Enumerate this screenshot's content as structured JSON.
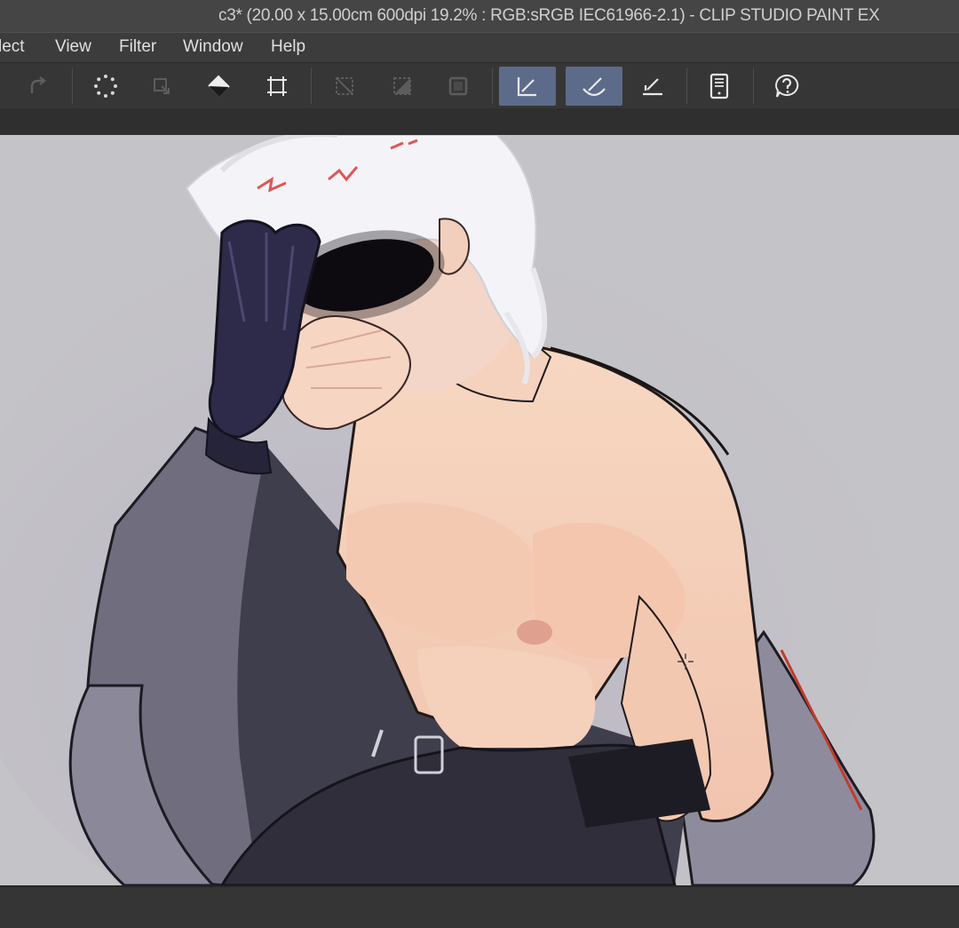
{
  "window": {
    "title": "c3* (20.00 x 15.00cm 600dpi 19.2% : RGB:sRGB IEC61966-2.1)  - CLIP STUDIO PAINT EX"
  },
  "menu": {
    "items": [
      {
        "label": "lect"
      },
      {
        "label": "View"
      },
      {
        "label": "Filter"
      },
      {
        "label": "Window"
      },
      {
        "label": "Help"
      }
    ]
  },
  "toolbar": {
    "buttons": [
      {
        "icon": "redo-icon",
        "state": "disabled"
      },
      {
        "icon": "loading-spinner-icon",
        "state": "normal"
      },
      {
        "icon": "transform-layer-icon",
        "state": "disabled"
      },
      {
        "icon": "fill-bucket-icon",
        "state": "normal"
      },
      {
        "icon": "crop-transform-icon",
        "state": "normal"
      },
      {
        "icon": "deselect-icon",
        "state": "disabled"
      },
      {
        "icon": "invert-selection-icon",
        "state": "disabled"
      },
      {
        "icon": "selection-border-icon",
        "state": "disabled"
      },
      {
        "icon": "snap-to-ruler-icon",
        "state": "active"
      },
      {
        "icon": "snap-to-special-ruler-icon",
        "state": "active"
      },
      {
        "icon": "snap-to-grid-icon",
        "state": "normal"
      },
      {
        "icon": "device-view-icon",
        "state": "normal"
      },
      {
        "icon": "help-icon",
        "state": "normal"
      }
    ]
  },
  "canvas": {
    "background_color": "#c4c3c7",
    "cursor_icon": "crosshair-cursor-icon"
  },
  "colors": {
    "active_button": "#5d6b8a",
    "titlebar": "#454545",
    "menubar": "#3c3c3c",
    "toolbar": "#363636"
  }
}
